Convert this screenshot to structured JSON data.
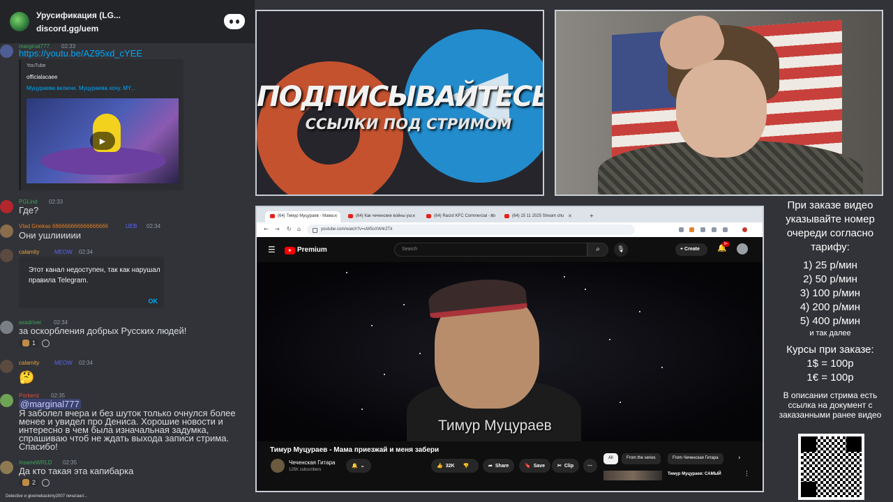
{
  "discord": {
    "server_title": "Урусификация (LG...",
    "invite_link": "discord.gg/uem",
    "messages": [
      {
        "user": "marginal777",
        "time": "02:33",
        "text": "https://youtu.be/AZ95xd_cYEE",
        "embed": {
          "source": "YouTube",
          "author": "officialacaee",
          "title": "Муцураева включи. Муцураева хочу. MY..."
        }
      },
      {
        "user": "PGLind",
        "time": "02:33",
        "text": "Где?"
      },
      {
        "user": "Vlad Gnekas 666666666666666666",
        "tag": "UEB",
        "time": "02:34",
        "text": "Они ушлиииии"
      },
      {
        "user": "calamity",
        "tag": "MEOW",
        "time": "02:34",
        "notice": {
          "text": "Этот канал недоступен, так как нарушал правила Telegram.",
          "button": "OK"
        }
      },
      {
        "user": "assdriver",
        "time": "02:34",
        "text": "за оскорбления добрых Русских людей!",
        "reaction_count": "1"
      },
      {
        "user": "calamity",
        "tag": "MEOW",
        "time": "02:34",
        "text": "🤔"
      },
      {
        "user": "Porkeriz",
        "time": "02:35",
        "mention": "@marginal777",
        "text": "Я заболел вчера и без шуток только очнулся более менее и увидел про Дениса. Хорошие новости и интересно в чем была изначальная задумка, спрашиваю чтоб не ждать выхода записи стрима. Спасибо!"
      },
      {
        "user": "InsaneWRLD",
        "time": "02:35",
        "text": "Да кто такая эта капибарка",
        "reaction_count": "2"
      }
    ],
    "typing": "Detective и givemebackmy2007 печатают..."
  },
  "promo": {
    "title": "ПОДПИСЫВАЙТЕСЬ",
    "subtitle": "ССЫЛКИ ПОД СТРИМОМ"
  },
  "browser": {
    "tabs": [
      {
        "label": "(64) Тимур Муцураев - Мама"
      },
      {
        "label": "(64) Как чеченские войны уш"
      },
      {
        "label": "(64) Racist KFC Commercial - Yo"
      },
      {
        "label": "(64) 15 11 2025 Stream chu"
      }
    ],
    "url": "youtube.com/watch?v=uW5oXW4rZTk",
    "youtube": {
      "brand": "Premium",
      "search_placeholder": "Search",
      "create_label": "Create",
      "notifications": "9+",
      "video_caption": "Тимур Муцураев",
      "video_title": "Тимур Муцураев - Мама приезжай и меня забери",
      "channel_name": "Чеченская Гитара",
      "channel_subs": "125K subscribers",
      "likes": "32K",
      "share_label": "Share",
      "save_label": "Save",
      "clip_label": "Clip",
      "chips": [
        "All",
        "From the series",
        "From Чеченская Гитара"
      ],
      "rec_title": "Тимур Муцураев: САМЫЙ"
    }
  },
  "info": {
    "intro": "При заказе видео указывайте номер очереди согласно тарифу:",
    "tariffs": [
      "1) 25 р/мин",
      "2) 50 р/мин",
      "3) 100 р/мин",
      "4) 200 р/мин",
      "5) 400 р/мин"
    ],
    "etc": "и так далее",
    "rates_title": "Курсы при заказе:",
    "rates": [
      "1$ = 100р",
      "1€ = 100р"
    ],
    "footer": "В описании стрима есть ссылка на документ с заказанными ранее видео"
  }
}
